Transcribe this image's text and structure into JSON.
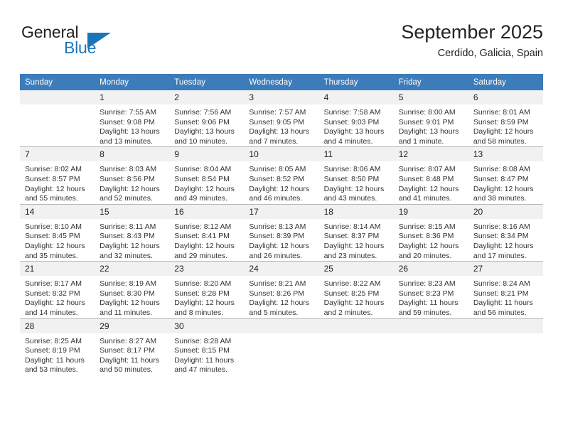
{
  "brand": {
    "name_part1": "General",
    "name_part2": "Blue",
    "triangle_color": "#1b75bb"
  },
  "header": {
    "title": "September 2025",
    "subtitle": "Cerdido, Galicia, Spain"
  },
  "theme": {
    "header_blue": "#3c7cba",
    "daynum_bg": "#f1f1f1",
    "grid_line": "#b6b6b6",
    "text": "#333333"
  },
  "weekdays": [
    "Sunday",
    "Monday",
    "Tuesday",
    "Wednesday",
    "Thursday",
    "Friday",
    "Saturday"
  ],
  "labels": {
    "sunrise_prefix": "Sunrise:",
    "sunset_prefix": "Sunset:",
    "daylight_prefix": "Daylight:"
  },
  "weeks": [
    [
      {
        "day": "",
        "blank": true
      },
      {
        "day": "1",
        "sunrise": "Sunrise: 7:55 AM",
        "sunset": "Sunset: 9:08 PM",
        "daylight_line1": "Daylight: 13 hours",
        "daylight_line2": "and 13 minutes."
      },
      {
        "day": "2",
        "sunrise": "Sunrise: 7:56 AM",
        "sunset": "Sunset: 9:06 PM",
        "daylight_line1": "Daylight: 13 hours",
        "daylight_line2": "and 10 minutes."
      },
      {
        "day": "3",
        "sunrise": "Sunrise: 7:57 AM",
        "sunset": "Sunset: 9:05 PM",
        "daylight_line1": "Daylight: 13 hours",
        "daylight_line2": "and 7 minutes."
      },
      {
        "day": "4",
        "sunrise": "Sunrise: 7:58 AM",
        "sunset": "Sunset: 9:03 PM",
        "daylight_line1": "Daylight: 13 hours",
        "daylight_line2": "and 4 minutes."
      },
      {
        "day": "5",
        "sunrise": "Sunrise: 8:00 AM",
        "sunset": "Sunset: 9:01 PM",
        "daylight_line1": "Daylight: 13 hours",
        "daylight_line2": "and 1 minute."
      },
      {
        "day": "6",
        "sunrise": "Sunrise: 8:01 AM",
        "sunset": "Sunset: 8:59 PM",
        "daylight_line1": "Daylight: 12 hours",
        "daylight_line2": "and 58 minutes."
      }
    ],
    [
      {
        "day": "7",
        "sunrise": "Sunrise: 8:02 AM",
        "sunset": "Sunset: 8:57 PM",
        "daylight_line1": "Daylight: 12 hours",
        "daylight_line2": "and 55 minutes."
      },
      {
        "day": "8",
        "sunrise": "Sunrise: 8:03 AM",
        "sunset": "Sunset: 8:56 PM",
        "daylight_line1": "Daylight: 12 hours",
        "daylight_line2": "and 52 minutes."
      },
      {
        "day": "9",
        "sunrise": "Sunrise: 8:04 AM",
        "sunset": "Sunset: 8:54 PM",
        "daylight_line1": "Daylight: 12 hours",
        "daylight_line2": "and 49 minutes."
      },
      {
        "day": "10",
        "sunrise": "Sunrise: 8:05 AM",
        "sunset": "Sunset: 8:52 PM",
        "daylight_line1": "Daylight: 12 hours",
        "daylight_line2": "and 46 minutes."
      },
      {
        "day": "11",
        "sunrise": "Sunrise: 8:06 AM",
        "sunset": "Sunset: 8:50 PM",
        "daylight_line1": "Daylight: 12 hours",
        "daylight_line2": "and 43 minutes."
      },
      {
        "day": "12",
        "sunrise": "Sunrise: 8:07 AM",
        "sunset": "Sunset: 8:48 PM",
        "daylight_line1": "Daylight: 12 hours",
        "daylight_line2": "and 41 minutes."
      },
      {
        "day": "13",
        "sunrise": "Sunrise: 8:08 AM",
        "sunset": "Sunset: 8:47 PM",
        "daylight_line1": "Daylight: 12 hours",
        "daylight_line2": "and 38 minutes."
      }
    ],
    [
      {
        "day": "14",
        "sunrise": "Sunrise: 8:10 AM",
        "sunset": "Sunset: 8:45 PM",
        "daylight_line1": "Daylight: 12 hours",
        "daylight_line2": "and 35 minutes."
      },
      {
        "day": "15",
        "sunrise": "Sunrise: 8:11 AM",
        "sunset": "Sunset: 8:43 PM",
        "daylight_line1": "Daylight: 12 hours",
        "daylight_line2": "and 32 minutes."
      },
      {
        "day": "16",
        "sunrise": "Sunrise: 8:12 AM",
        "sunset": "Sunset: 8:41 PM",
        "daylight_line1": "Daylight: 12 hours",
        "daylight_line2": "and 29 minutes."
      },
      {
        "day": "17",
        "sunrise": "Sunrise: 8:13 AM",
        "sunset": "Sunset: 8:39 PM",
        "daylight_line1": "Daylight: 12 hours",
        "daylight_line2": "and 26 minutes."
      },
      {
        "day": "18",
        "sunrise": "Sunrise: 8:14 AM",
        "sunset": "Sunset: 8:37 PM",
        "daylight_line1": "Daylight: 12 hours",
        "daylight_line2": "and 23 minutes."
      },
      {
        "day": "19",
        "sunrise": "Sunrise: 8:15 AM",
        "sunset": "Sunset: 8:36 PM",
        "daylight_line1": "Daylight: 12 hours",
        "daylight_line2": "and 20 minutes."
      },
      {
        "day": "20",
        "sunrise": "Sunrise: 8:16 AM",
        "sunset": "Sunset: 8:34 PM",
        "daylight_line1": "Daylight: 12 hours",
        "daylight_line2": "and 17 minutes."
      }
    ],
    [
      {
        "day": "21",
        "sunrise": "Sunrise: 8:17 AM",
        "sunset": "Sunset: 8:32 PM",
        "daylight_line1": "Daylight: 12 hours",
        "daylight_line2": "and 14 minutes."
      },
      {
        "day": "22",
        "sunrise": "Sunrise: 8:19 AM",
        "sunset": "Sunset: 8:30 PM",
        "daylight_line1": "Daylight: 12 hours",
        "daylight_line2": "and 11 minutes."
      },
      {
        "day": "23",
        "sunrise": "Sunrise: 8:20 AM",
        "sunset": "Sunset: 8:28 PM",
        "daylight_line1": "Daylight: 12 hours",
        "daylight_line2": "and 8 minutes."
      },
      {
        "day": "24",
        "sunrise": "Sunrise: 8:21 AM",
        "sunset": "Sunset: 8:26 PM",
        "daylight_line1": "Daylight: 12 hours",
        "daylight_line2": "and 5 minutes."
      },
      {
        "day": "25",
        "sunrise": "Sunrise: 8:22 AM",
        "sunset": "Sunset: 8:25 PM",
        "daylight_line1": "Daylight: 12 hours",
        "daylight_line2": "and 2 minutes."
      },
      {
        "day": "26",
        "sunrise": "Sunrise: 8:23 AM",
        "sunset": "Sunset: 8:23 PM",
        "daylight_line1": "Daylight: 11 hours",
        "daylight_line2": "and 59 minutes."
      },
      {
        "day": "27",
        "sunrise": "Sunrise: 8:24 AM",
        "sunset": "Sunset: 8:21 PM",
        "daylight_line1": "Daylight: 11 hours",
        "daylight_line2": "and 56 minutes."
      }
    ],
    [
      {
        "day": "28",
        "sunrise": "Sunrise: 8:25 AM",
        "sunset": "Sunset: 8:19 PM",
        "daylight_line1": "Daylight: 11 hours",
        "daylight_line2": "and 53 minutes."
      },
      {
        "day": "29",
        "sunrise": "Sunrise: 8:27 AM",
        "sunset": "Sunset: 8:17 PM",
        "daylight_line1": "Daylight: 11 hours",
        "daylight_line2": "and 50 minutes."
      },
      {
        "day": "30",
        "sunrise": "Sunrise: 8:28 AM",
        "sunset": "Sunset: 8:15 PM",
        "daylight_line1": "Daylight: 11 hours",
        "daylight_line2": "and 47 minutes."
      },
      {
        "day": "",
        "blank": true
      },
      {
        "day": "",
        "blank": true
      },
      {
        "day": "",
        "blank": true
      },
      {
        "day": "",
        "blank": true
      }
    ]
  ]
}
